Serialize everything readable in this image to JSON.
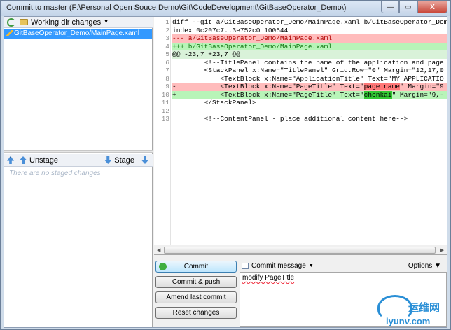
{
  "window": {
    "title": "Commit to master (F:\\Personal Open Souce Demo\\Git\\CodeDevelopment\\GitBaseOperator_Demo\\)",
    "minimize": "—",
    "maximize": "▭",
    "close": "X"
  },
  "working": {
    "dropdown_label": "Working dir changes",
    "files": [
      "GitBaseOperator_Demo/MainPage.xaml"
    ]
  },
  "staging": {
    "unstage_label": "Unstage",
    "stage_label": "Stage",
    "empty_text": "There are no staged changes"
  },
  "diff": {
    "lines": [
      {
        "n": "1",
        "text": "diff --git a/GitBaseOperator_Demo/MainPage.xaml b/GitBaseOperator_Dem"
      },
      {
        "n": "2",
        "text": "index 0c207c7..3e752c0 100644"
      },
      {
        "n": "3",
        "text": "--- a/GitBaseOperator_Demo/MainPage.xaml"
      },
      {
        "n": "4",
        "text": "+++ b/GitBaseOperator_Demo/MainPage.xaml"
      },
      {
        "n": "5",
        "text": "@@ -23,7 +23,7 @@"
      },
      {
        "n": "6",
        "text": "        <!--TitlePanel contains the name of the application and page"
      },
      {
        "n": "7",
        "text": "        <StackPanel x:Name=\"TitlePanel\" Grid.Row=\"0\" Margin=\"12,17,0"
      },
      {
        "n": "8",
        "text": "            <TextBlock x:Name=\"ApplicationTitle\" Text=\"MY APPLICATIO"
      },
      {
        "n": "9",
        "pre": "-           <TextBlock x:Name=\"PageTitle\" Text=\"",
        "hl": "page name",
        "post": "\" Margin=\"9"
      },
      {
        "n": "10",
        "pre": "+           <TextBlock x:Name=\"PageTitle\" Text=\"",
        "hl": "chenkai",
        "post": "\" Margin=\"9,-"
      },
      {
        "n": "11",
        "text": "        </StackPanel>"
      },
      {
        "n": "12",
        "text": ""
      },
      {
        "n": "13",
        "text": "        <!--ContentPanel - place additional content here-->"
      }
    ]
  },
  "actions": {
    "commit": "Commit",
    "commit_push": "Commit & push",
    "amend": "Amend last commit",
    "reset": "Reset changes"
  },
  "message": {
    "label": "Commit message",
    "options": "Options",
    "text": "modify PageTitle"
  },
  "watermark": {
    "brand": "运维网",
    "url": "iyunv.com"
  }
}
